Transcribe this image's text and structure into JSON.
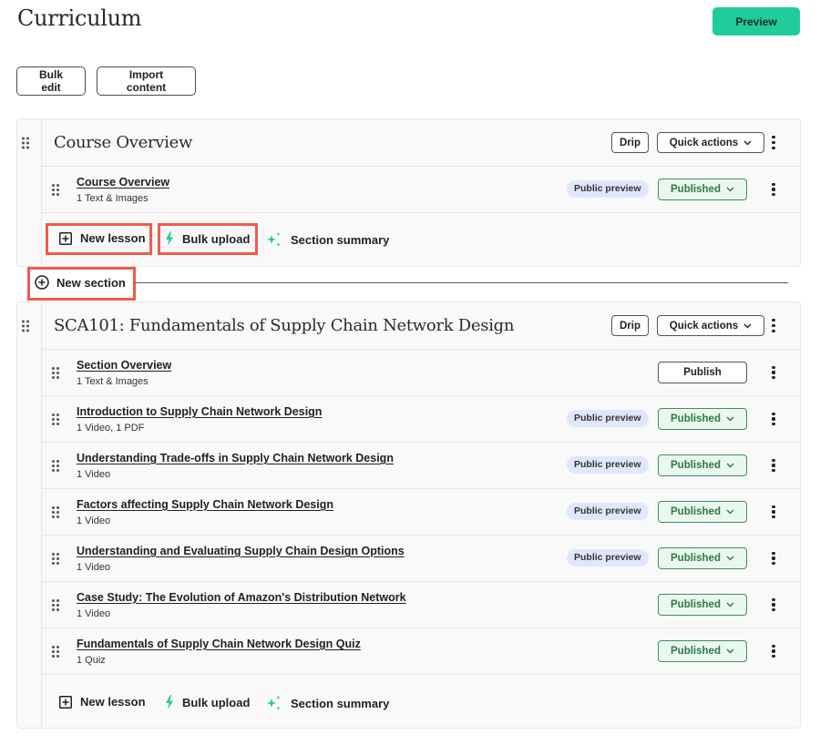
{
  "header": {
    "title": "Curriculum",
    "preview_label": "Preview",
    "bulk_edit_label": "Bulk edit",
    "import_content_label": "Import content"
  },
  "colors": {
    "accent": "#21cc9c",
    "published_border": "#3e8e5c",
    "published_bg": "#eaf7ee",
    "published_text": "#2d7a47",
    "public_preview_bg": "#dfe8fb",
    "highlight": "#f25a4a"
  },
  "new_section_label": "New section",
  "sections": [
    {
      "title": "Course Overview",
      "drip_label": "Drip",
      "quick_actions_label": "Quick actions",
      "lessons": [
        {
          "title": "Course Overview",
          "subtitle": "1 Text & Images",
          "public_preview": "Public preview",
          "status": "Published"
        }
      ],
      "footer": {
        "new_lesson": "New lesson",
        "bulk_upload": "Bulk upload",
        "section_summary": "Section summary"
      }
    },
    {
      "title": "SCA101: Fundamentals of Supply Chain Network Design",
      "drip_label": "Drip",
      "quick_actions_label": "Quick actions",
      "lessons": [
        {
          "title": "Section Overview",
          "subtitle": "1 Text & Images",
          "public_preview": null,
          "status": "Publish"
        },
        {
          "title": "Introduction to Supply Chain Network Design",
          "subtitle": "1 Video, 1 PDF",
          "public_preview": "Public preview",
          "status": "Published"
        },
        {
          "title": "Understanding Trade-offs in Supply Chain Network Design",
          "subtitle": "1 Video",
          "public_preview": "Public preview",
          "status": "Published"
        },
        {
          "title": "Factors affecting Supply Chain Network Design",
          "subtitle": "1 Video",
          "public_preview": "Public preview",
          "status": "Published"
        },
        {
          "title": "Understanding and Evaluating Supply Chain Design Options",
          "subtitle": "1 Video",
          "public_preview": "Public preview",
          "status": "Published"
        },
        {
          "title": "Case Study: The Evolution of Amazon's Distribution Network",
          "subtitle": "1 Video",
          "public_preview": null,
          "status": "Published"
        },
        {
          "title": "Fundamentals of Supply Chain Network Design Quiz",
          "subtitle": "1 Quiz",
          "public_preview": null,
          "status": "Published"
        }
      ],
      "footer": {
        "new_lesson": "New lesson",
        "bulk_upload": "Bulk upload",
        "section_summary": "Section summary"
      }
    }
  ],
  "icons": {
    "drag": "drag-handle-icon",
    "kebab": "more-vertical-icon",
    "chevron": "chevron-down-icon",
    "new_lesson": "plus-square-icon",
    "bulk_upload": "lightning-icon",
    "section_summary": "sparkle-icon",
    "new_section": "plus-circle-icon"
  }
}
